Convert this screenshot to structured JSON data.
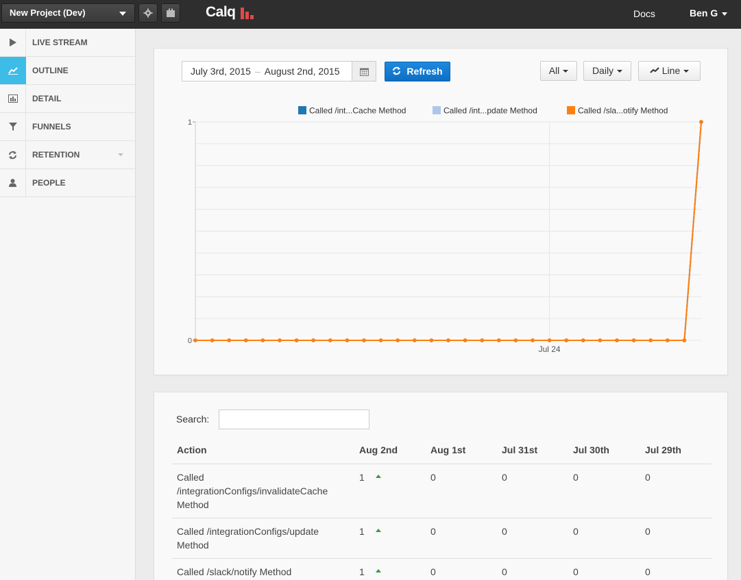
{
  "header": {
    "project_select": "New Project (Dev)",
    "settings_icon": "gear-icon",
    "share_icon": "present-icon",
    "logo_text": "Calq",
    "docs_link": "Docs",
    "user_name": "Ben G"
  },
  "sidebar": {
    "items": [
      {
        "label": "LIVE STREAM",
        "icon": "play-icon"
      },
      {
        "label": "OUTLINE",
        "icon": "line-chart-icon",
        "active": true
      },
      {
        "label": "DETAIL",
        "icon": "bar-chart-icon"
      },
      {
        "label": "FUNNELS",
        "icon": "funnel-icon"
      },
      {
        "label": "RETENTION",
        "icon": "refresh-icon"
      },
      {
        "label": "PEOPLE",
        "icon": "user-icon"
      }
    ]
  },
  "controls": {
    "date_start": "July 3rd, 2015",
    "date_sep": "–",
    "date_end": "August 2nd, 2015",
    "refresh_label": "Refresh",
    "filter_label": "All",
    "interval_label": "Daily",
    "chart_type_label": "Line"
  },
  "colors": {
    "accent": "#3dbce8",
    "refresh": "#1079d2",
    "series": [
      "#1f77b4",
      "#aec7e8",
      "#ff7f0e"
    ]
  },
  "chart_data": {
    "type": "line",
    "x": [
      "Jul 3",
      "Jul 4",
      "Jul 5",
      "Jul 6",
      "Jul 7",
      "Jul 8",
      "Jul 9",
      "Jul 10",
      "Jul 11",
      "Jul 12",
      "Jul 13",
      "Jul 14",
      "Jul 15",
      "Jul 16",
      "Jul 17",
      "Jul 18",
      "Jul 19",
      "Jul 20",
      "Jul 21",
      "Jul 22",
      "Jul 23",
      "Jul 24",
      "Jul 25",
      "Jul 26",
      "Jul 27",
      "Jul 28",
      "Jul 29",
      "Jul 30",
      "Jul 31",
      "Aug 1",
      "Aug 2"
    ],
    "x_tick_labels": [
      "Jul 24"
    ],
    "y_tick_labels": [
      "0",
      "1"
    ],
    "ylim": [
      0,
      1
    ],
    "legend_position": "top",
    "series": [
      {
        "name": "Called /int...Cache Method",
        "values": [
          0,
          0,
          0,
          0,
          0,
          0,
          0,
          0,
          0,
          0,
          0,
          0,
          0,
          0,
          0,
          0,
          0,
          0,
          0,
          0,
          0,
          0,
          0,
          0,
          0,
          0,
          0,
          0,
          0,
          0,
          1
        ]
      },
      {
        "name": "Called /int...pdate Method",
        "values": [
          0,
          0,
          0,
          0,
          0,
          0,
          0,
          0,
          0,
          0,
          0,
          0,
          0,
          0,
          0,
          0,
          0,
          0,
          0,
          0,
          0,
          0,
          0,
          0,
          0,
          0,
          0,
          0,
          0,
          0,
          1
        ]
      },
      {
        "name": "Called /sla...otify Method",
        "values": [
          0,
          0,
          0,
          0,
          0,
          0,
          0,
          0,
          0,
          0,
          0,
          0,
          0,
          0,
          0,
          0,
          0,
          0,
          0,
          0,
          0,
          0,
          0,
          0,
          0,
          0,
          0,
          0,
          0,
          0,
          1
        ]
      }
    ]
  },
  "table": {
    "search_label": "Search:",
    "search_value": "",
    "columns": [
      "Action",
      "Aug 2nd",
      "Aug 1st",
      "Jul 31st",
      "Jul 30th",
      "Jul 29th"
    ],
    "rows": [
      {
        "action": "Called /integrationConfigs/invalidateCache Method",
        "values": [
          "1",
          "0",
          "0",
          "0",
          "0"
        ],
        "trend": "up"
      },
      {
        "action": "Called /integrationConfigs/update Method",
        "values": [
          "1",
          "0",
          "0",
          "0",
          "0"
        ],
        "trend": "up"
      },
      {
        "action": "Called /slack/notify Method",
        "values": [
          "1",
          "0",
          "0",
          "0",
          "0"
        ],
        "trend": "up"
      }
    ]
  }
}
